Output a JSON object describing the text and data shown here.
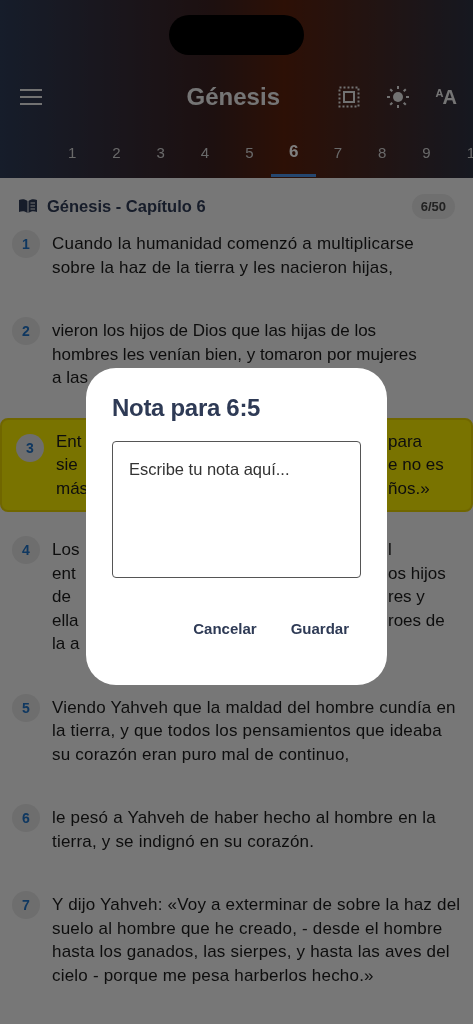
{
  "header": {
    "title": "Génesis",
    "font_button": {
      "small": "A",
      "large": "A"
    }
  },
  "chapter_tabs": [
    {
      "label": "1",
      "selected": false
    },
    {
      "label": "2",
      "selected": false
    },
    {
      "label": "3",
      "selected": false
    },
    {
      "label": "4",
      "selected": false
    },
    {
      "label": "5",
      "selected": false
    },
    {
      "label": "6",
      "selected": true
    },
    {
      "label": "7",
      "selected": false
    },
    {
      "label": "8",
      "selected": false
    },
    {
      "label": "9",
      "selected": false
    },
    {
      "label": "1",
      "selected": false
    }
  ],
  "chapter_heading": {
    "title": "Génesis - Capítulo 6",
    "badge": "6/50"
  },
  "verses": [
    {
      "number": "1",
      "highlighted": false,
      "text": "Cuando la humanidad comenzó a multiplicarse sobre la haz de la tierra y les nacieron hijas,"
    },
    {
      "number": "2",
      "highlighted": false,
      "lines": [
        {
          "left": "vieron los hijos de Dios que las hijas de los"
        },
        {
          "left": "hombres les venían bien, y tomaron por mujeres"
        },
        {
          "left": "a las"
        }
      ]
    },
    {
      "number": "3",
      "highlighted": true,
      "lines": [
        {
          "left": "Ent",
          "right": "para"
        },
        {
          "left": "sie",
          "right": "e no es"
        },
        {
          "left": "más",
          "right": "ños.»"
        }
      ]
    },
    {
      "number": "4",
      "highlighted": false,
      "lines": [
        {
          "left": "Los",
          "right": "l"
        },
        {
          "left": "ent",
          "right": "os hijos"
        },
        {
          "left": "de",
          "right": "res y"
        },
        {
          "left": "ella",
          "right": "roes de"
        },
        {
          "left": "la a"
        }
      ]
    },
    {
      "number": "5",
      "highlighted": false,
      "text": "Viendo Yahveh que la maldad del hombre cundía en la tierra, y que todos los pensamientos que ideaba su corazón eran puro mal de continuo,"
    },
    {
      "number": "6",
      "highlighted": false,
      "text": "le pesó a Yahveh de haber hecho al hombre en la tierra, y se indignó en su corazón."
    },
    {
      "number": "7",
      "highlighted": false,
      "text": "Y dijo Yahveh: «Voy a exterminar de sobre la haz del suelo al hombre que he creado, - desde el hombre hasta los ganados, las sierpes, y hasta las aves del cielo - porque me pesa harberlos hecho.»"
    }
  ],
  "note_dialog": {
    "title": "Nota para 6:5",
    "placeholder": "Escribe tu nota aquí...",
    "buttons": [
      "Cancelar",
      "Guardar"
    ]
  }
}
